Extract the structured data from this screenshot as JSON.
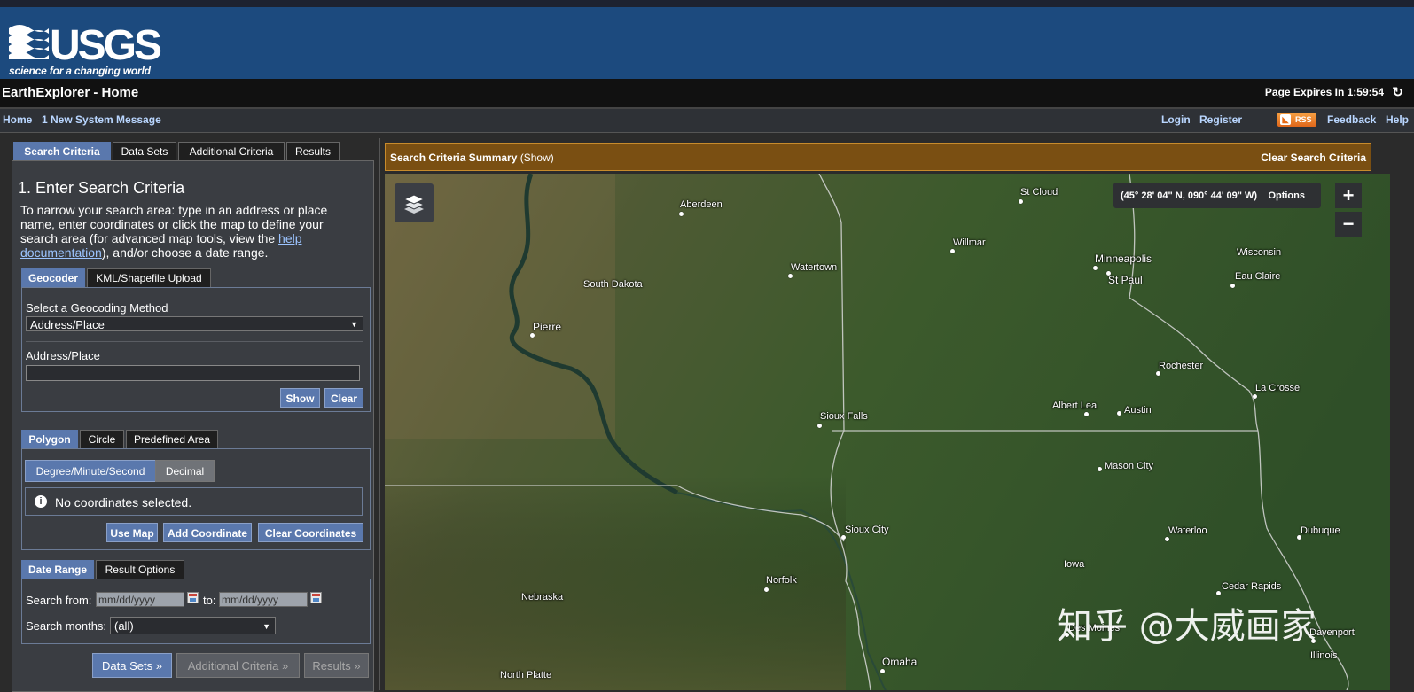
{
  "header": {
    "logo_text": "USGS",
    "tagline": "science for a changing world",
    "app_title": "EarthExplorer - Home",
    "expires": "Page Expires In 1:59:54",
    "refresh_icon": "refresh-icon"
  },
  "nav": {
    "home": "Home",
    "message": "1 New System Message",
    "login": "Login",
    "register": "Register",
    "rss": "RSS",
    "feedback": "Feedback",
    "help": "Help"
  },
  "main_tabs": [
    "Search Criteria",
    "Data Sets",
    "Additional Criteria",
    "Results"
  ],
  "search": {
    "heading": "1. Enter Search Criteria",
    "intro_before": "To narrow your search area: type in an address or place name, enter coordinates or click the map to define your search area (for advanced map tools, view the ",
    "intro_link": "help documentation",
    "intro_after": "), and/or choose a date range."
  },
  "geo_tabs": [
    "Geocoder",
    "KML/Shapefile Upload"
  ],
  "geocoder": {
    "method_label": "Select a Geocoding Method",
    "method_value": "Address/Place",
    "address_label": "Address/Place",
    "address_value": "",
    "show_button": "Show",
    "clear_button": "Clear"
  },
  "area_tabs": [
    "Polygon",
    "Circle",
    "Predefined Area"
  ],
  "coord_format": [
    "Degree/Minute/Second",
    "Decimal"
  ],
  "coords": {
    "empty_message": "No coordinates selected.",
    "use_map": "Use Map",
    "add_coordinate": "Add Coordinate",
    "clear_coordinates": "Clear Coordinates"
  },
  "date_tabs": [
    "Date Range",
    "Result Options"
  ],
  "dates": {
    "from_label": "Search from:",
    "from_placeholder": "mm/dd/yyyy",
    "to_label": "to:",
    "to_placeholder": "mm/dd/yyyy",
    "months_label": "Search months:",
    "months_value": "(all)"
  },
  "bottom_buttons": [
    "Data Sets »",
    "Additional Criteria »",
    "Results »"
  ],
  "summary_bar": {
    "title": "Search Criteria Summary",
    "show": "(Show)",
    "clear": "Clear Search Criteria"
  },
  "map": {
    "coordinate": "(45° 28' 04\" N, 090° 44' 09\" W)",
    "options": "Options",
    "zoom_in": "+",
    "zoom_out": "−",
    "watermark": "知乎 @大威画家",
    "labels": [
      "Aberdeen",
      "St Cloud",
      "Willmar",
      "Minneapolis",
      "St Paul",
      "Wisconsin",
      "Eau Claire",
      "Watertown",
      "South Dakota",
      "Pierre",
      "Rochester",
      "La Crosse",
      "Albert Lea",
      "Austin",
      "Sioux Falls",
      "Mason City",
      "Sioux City",
      "Waterloo",
      "Dubuque",
      "Iowa",
      "Norfolk",
      "Cedar Rapids",
      "Nebraska",
      "Des Moines",
      "Davenport",
      "Illinois",
      "Omaha",
      "North Platte"
    ]
  }
}
